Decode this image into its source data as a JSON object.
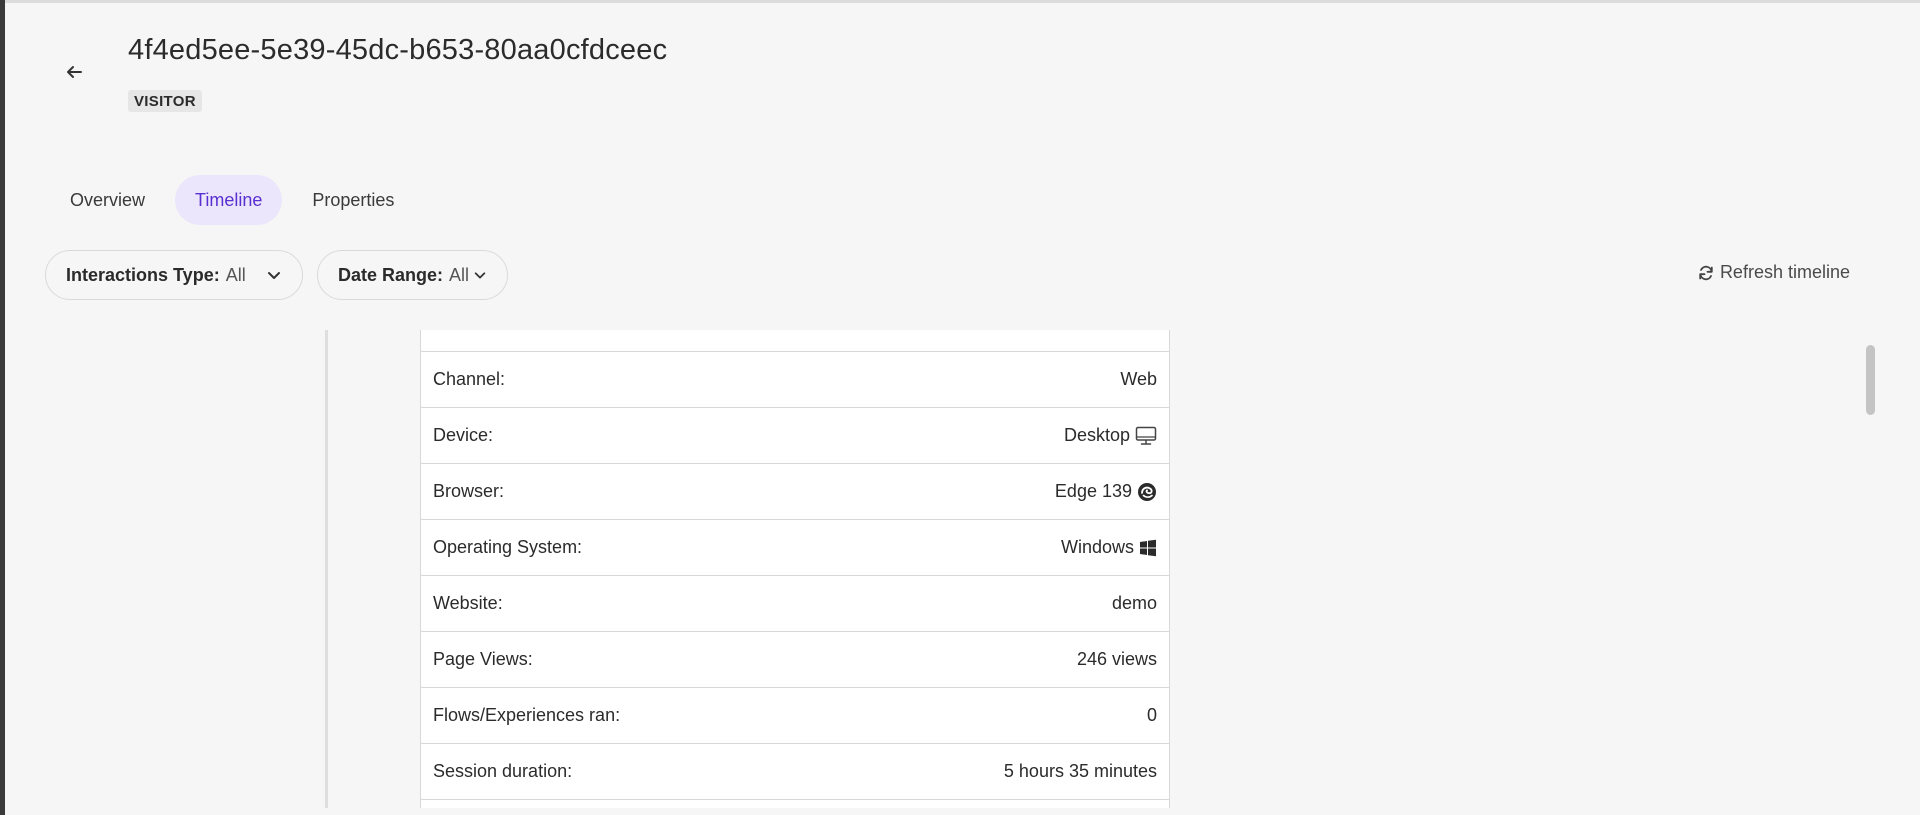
{
  "header": {
    "title": "4f4ed5ee-5e39-45dc-b653-80aa0cfdceec",
    "badge": "VISITOR"
  },
  "tabs": [
    {
      "label": "Overview",
      "active": false
    },
    {
      "label": "Timeline",
      "active": true
    },
    {
      "label": "Properties",
      "active": false
    }
  ],
  "filters": {
    "interactions": {
      "label": "Interactions Type:",
      "value": "All"
    },
    "date_range": {
      "label": "Date Range:",
      "value": "All"
    }
  },
  "refresh_label": "Refresh timeline",
  "details": [
    {
      "label": "Channel:",
      "value": "Web",
      "icon": ""
    },
    {
      "label": "Device:",
      "value": "Desktop",
      "icon": "desktop-icon"
    },
    {
      "label": "Browser:",
      "value": "Edge 139",
      "icon": "edge-browser-icon"
    },
    {
      "label": "Operating System:",
      "value": "Windows",
      "icon": "windows-icon"
    },
    {
      "label": "Website:",
      "value": "demo",
      "icon": ""
    },
    {
      "label": "Page Views:",
      "value": "246 views",
      "icon": ""
    },
    {
      "label": "Flows/Experiences ran:",
      "value": "0",
      "icon": ""
    },
    {
      "label": "Session duration:",
      "value": "5 hours 35 minutes",
      "icon": ""
    }
  ],
  "colors": {
    "accent": "#5a2fd1",
    "accent_bg": "#ebe6fb",
    "background": "#f6f6f6"
  }
}
